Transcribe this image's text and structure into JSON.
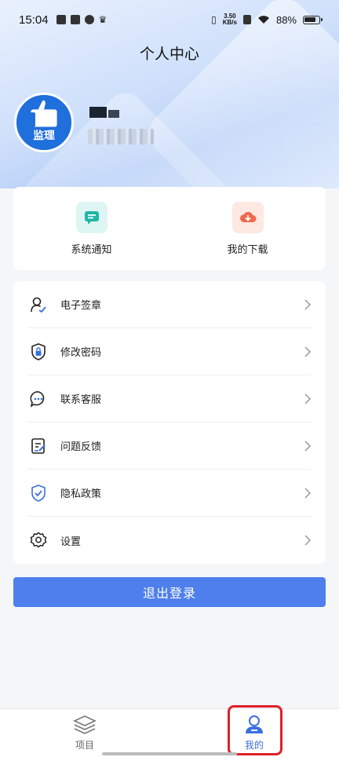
{
  "status_bar": {
    "time": "15:04",
    "net_speed_value": "3.50",
    "net_speed_unit": "KB/s",
    "battery": "88%"
  },
  "header": {
    "title": "个人中心"
  },
  "quick_actions": [
    {
      "label": "系统通知",
      "icon": "message-icon"
    },
    {
      "label": "我的下载",
      "icon": "cloud-download-icon"
    }
  ],
  "menu": [
    {
      "label": "电子签章",
      "icon": "user-sign-icon"
    },
    {
      "label": "修改密码",
      "icon": "lock-shield-icon"
    },
    {
      "label": "联系客服",
      "icon": "chat-bubble-icon"
    },
    {
      "label": "问题反馈",
      "icon": "feedback-icon"
    },
    {
      "label": "隐私政策",
      "icon": "shield-check-icon"
    },
    {
      "label": "设置",
      "icon": "gear-icon"
    }
  ],
  "logout_label": "退出登录",
  "tabs": [
    {
      "label": "项目",
      "icon": "layers-icon",
      "active": false
    },
    {
      "label": "我的",
      "icon": "person-icon",
      "active": true
    }
  ],
  "avatar_badge_text": "监理",
  "colors": {
    "accent": "#4e7fed",
    "tab_active": "#3b6fdf",
    "highlight": "#e0202a"
  }
}
